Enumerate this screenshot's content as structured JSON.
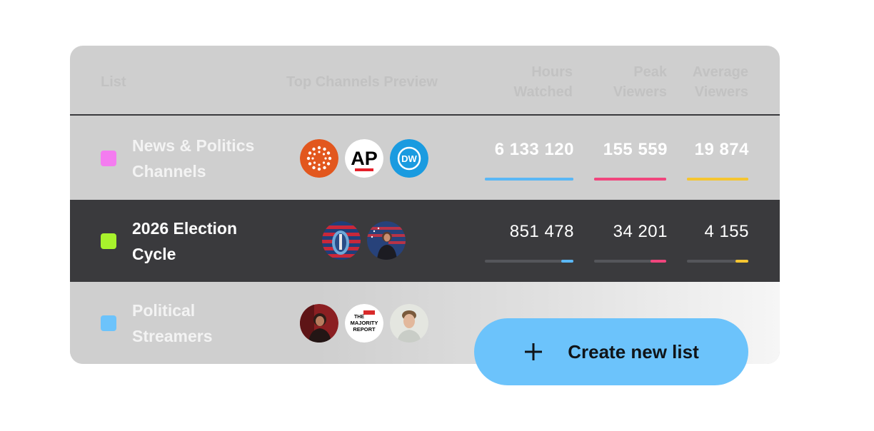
{
  "headers": {
    "list": "List",
    "preview": "Top Channels Preview",
    "hours_line1": "Hours",
    "hours_line2": "Watched",
    "peak_line1": "Peak",
    "peak_line2": "Viewers",
    "avg_line1": "Average",
    "avg_line2": "Viewers"
  },
  "rows": [
    {
      "name_line1": "News & Politics",
      "name_line2": "Channels",
      "color": "#f47cf0",
      "channels": [
        "rt-logo-icon",
        "ap-logo-icon",
        "dw-logo-icon"
      ],
      "hours": "6 133 120",
      "peak": "155 559",
      "average": "19 874",
      "hours_fraction": 1.0,
      "peak_fraction": 1.0,
      "average_fraction": 1.0
    },
    {
      "name_line1": "2026 Election",
      "name_line2": "Cycle",
      "color": "#a8f22c",
      "channels": [
        "flag-portrait-icon",
        "speaker-portrait-icon"
      ],
      "hours": "851 478",
      "peak": "34 201",
      "average": "4 155",
      "hours_fraction": 0.14,
      "peak_fraction": 0.22,
      "average_fraction": 0.21
    },
    {
      "name_line1": "Political",
      "name_line2": "Streamers",
      "color": "#6cc3fb",
      "channels": [
        "streamer-portrait-icon",
        "majority-report-logo-icon",
        "man-portrait-icon"
      ]
    }
  ],
  "logos": {
    "ap": "AP",
    "dw": "DW",
    "majority_report_top": "THE",
    "majority_report_mid": "MAJORITY",
    "majority_report_bottom": "REPORT"
  },
  "colors": {
    "hours": "#5ab7f5",
    "peak": "#f0457d",
    "average": "#f5c531"
  },
  "cta": {
    "label": "Create new list",
    "icon": "plus-icon"
  }
}
